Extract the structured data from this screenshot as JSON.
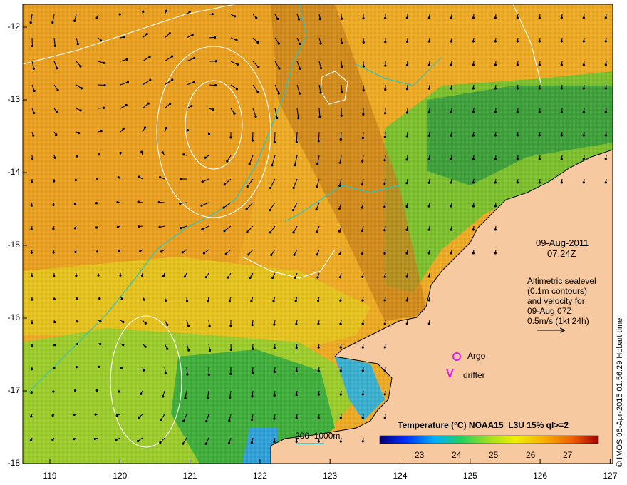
{
  "map": {
    "date": "09-Aug-2011",
    "time": "07:24Z",
    "legend_note": {
      "line1": "Altimetric sealevel",
      "line2": "(0.1m contours)",
      "line3": "and velocity for",
      "line4": "09-Aug 07Z",
      "scale": "0.5m/s (1kt 24h)"
    },
    "argo_label": "Argo",
    "drifter_label": "drifter",
    "drifter_symbol": "V",
    "depth_legend": "200  1000m",
    "colorbar": {
      "title": "Temperature (°C) NOAA15_L3U 15% ql>=2",
      "ticks": [
        "23",
        "24",
        "25",
        "26",
        "27"
      ]
    },
    "credit": "© IMOS 06-Apr-2015 01:56:29 Hobart time",
    "lat_ticks": [
      "-12",
      "-13",
      "-14",
      "-15",
      "-16",
      "-17",
      "-18"
    ],
    "lon_ticks": [
      "119",
      "120",
      "121",
      "122",
      "123",
      "124",
      "125",
      "126",
      "127"
    ],
    "colors": {
      "land": "#f6c9a0",
      "warm": "#e8a020",
      "mid": "#f2c21a",
      "cool": "#8ccc2a",
      "cold": "#2fa040",
      "isobath": "#20c8c8",
      "contour": "#ffffff",
      "argo": "#e020e0"
    }
  }
}
